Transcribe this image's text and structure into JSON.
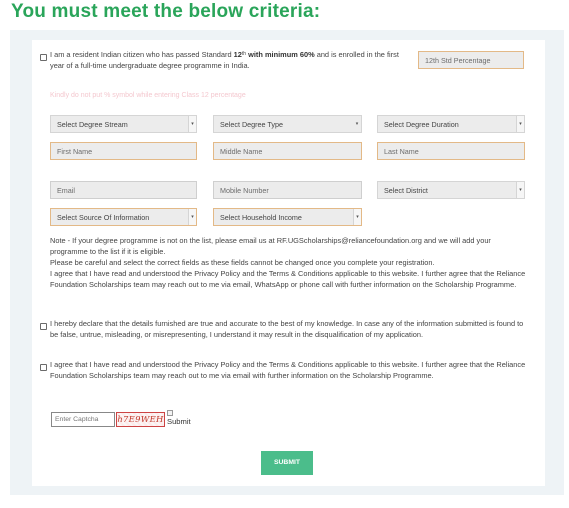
{
  "heading": "You must meet the below criteria:",
  "eligibility": {
    "text_before": "I am a resident Indian citizen who has passed Standard ",
    "num_12": "12",
    "sup_th": "th",
    "bold_min": " with minimum 60%",
    "text_after": " and is enrolled in the first year of a full-time undergraduate degree programme in India.",
    "percentage_placeholder": "12th Std Percentage",
    "percentage_hint": "Kindly do not put % symbol while entering Class 12 percentage"
  },
  "form": {
    "degree_stream": "Select Degree Stream",
    "degree_type": "Select Degree Type",
    "degree_duration": "Select Degree Duration",
    "first_name": "First Name",
    "middle_name": "Middle Name",
    "last_name": "Last Name",
    "email": "Email",
    "mobile": "Mobile Number",
    "district": "Select District",
    "source": "Select Source Of Information",
    "household_income": "Select Household Income"
  },
  "notes": {
    "line1": "Note - If your degree programme is not on the list, please email us at RF.UGScholarships@reliancefoundation.org and we will add your programme to the list if it is eligible.",
    "line2": "Please be careful and select the correct fields as these fields cannot be changed once you complete your registration.",
    "line3": "I agree that I have read and understood the Privacy Policy and the Terms & Conditions applicable to this website. I further agree that the Reliance Foundation Scholarships team may reach out to me via email, WhatsApp or phone call with further information on the Scholarship Programme."
  },
  "declarations": {
    "accuracy": "I hereby declare that the details furnished are true and accurate to the best of my knowledge. In case any of the information submitted is found to be false, untrue, misleading, or misrepresenting, I understand it may result in the disqualification of my application.",
    "privacy": "I agree that I have read and understood the Privacy Policy and the Terms & Conditions applicable to this website. I further agree that the Reliance Foundation Scholarships team may reach out to me via email with further information on the Scholarship Programme."
  },
  "captcha": {
    "placeholder": "Enter Captcha",
    "code": "h7E9WEH",
    "refresh_alt": "Submit"
  },
  "submit_label": "SUBMIT",
  "colors": {
    "heading": "#2aa55a",
    "submit": "#4bbd8b",
    "captcha": "#c0392b"
  }
}
